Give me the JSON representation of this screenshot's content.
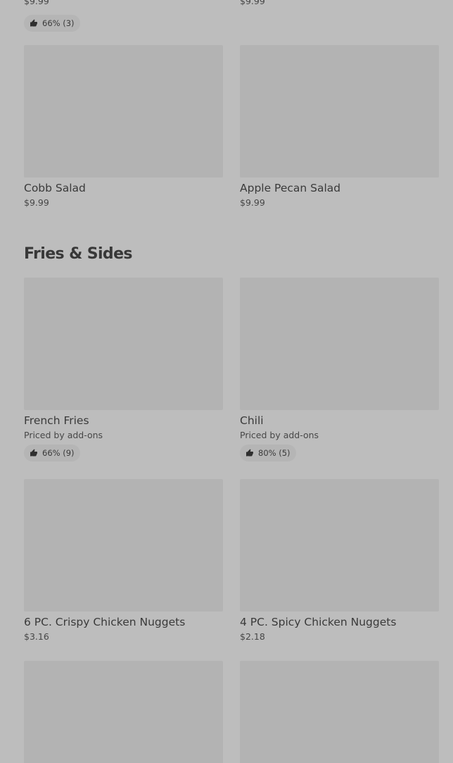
{
  "top_partial": {
    "left_price": "$9.99",
    "left_rating": "66% (3)",
    "right_price": "$9.99"
  },
  "salads": [
    {
      "name": "Cobb Salad",
      "price": "$9.99"
    },
    {
      "name": "Apple Pecan Salad",
      "price": "$9.99"
    }
  ],
  "fries_sides": {
    "title": "Fries & Sides",
    "items": [
      {
        "name": "French Fries",
        "price": "Priced by add-ons",
        "rating": "66% (9)"
      },
      {
        "name": "Chili",
        "price": "Priced by add-ons",
        "rating": "80% (5)"
      },
      {
        "name": "6 PC. Crispy Chicken Nuggets",
        "price": "$3.16"
      },
      {
        "name": "4 PC. Spicy Chicken Nuggets",
        "price": "$2.18"
      }
    ]
  },
  "icons": {
    "rating": "thumbs-up-icon"
  },
  "colors": {
    "page_background": "#bdbdbd",
    "image_placeholder": "#b3b3b3",
    "rating_pill": "#b5b5b5",
    "text": "#3a3a3a"
  }
}
